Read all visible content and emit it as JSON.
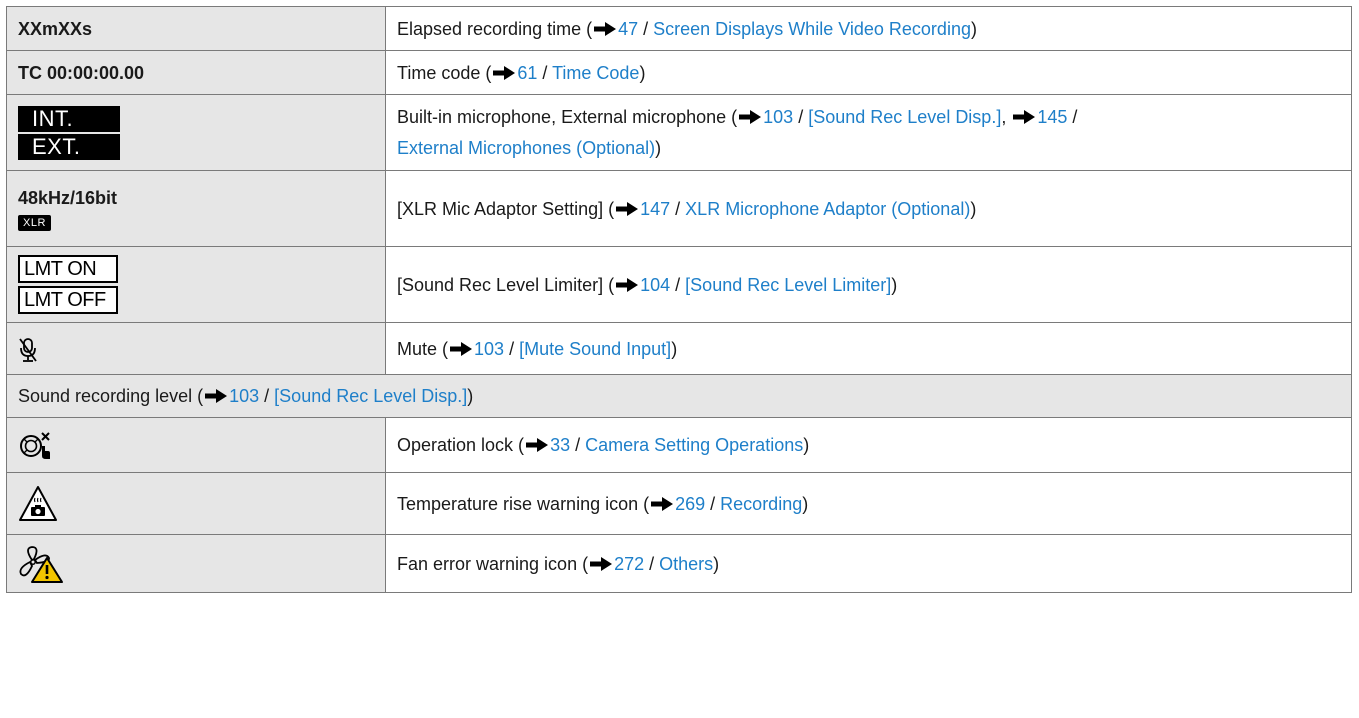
{
  "rows": [
    {
      "icon_text": "XXmXXs",
      "desc": "Elapsed recording time (",
      "page": "47",
      "sep": " / ",
      "link": "Screen Displays While Video Recording",
      "end": ")"
    },
    {
      "icon_text": "TC 00:00:00.00",
      "desc": "Time code (",
      "page": "61",
      "sep": " / ",
      "link": "Time Code",
      "end": ")"
    },
    {
      "icon_text_1": "INT.",
      "icon_text_2": "EXT.",
      "desc": "Built-in microphone, External microphone (",
      "page": "103",
      "sep": " / ",
      "link": "[Sound Rec Level Disp.]",
      "mid": ", ",
      "page2": "145",
      "sep2": " /",
      "link2": "External Microphones (Optional)",
      "end": ")"
    },
    {
      "icon_text": "48kHz/16bit",
      "badge": "XLR",
      "desc": "[XLR Mic Adaptor Setting] (",
      "page": "147",
      "sep": " / ",
      "link": "XLR Microphone Adaptor (Optional)",
      "end": ")"
    },
    {
      "icon_text_1": "LMT ON",
      "icon_text_2": "LMT OFF",
      "desc": "[Sound Rec Level Limiter] (",
      "page": "104",
      "sep": " / ",
      "link": "[Sound Rec Level Limiter]",
      "end": ")"
    },
    {
      "icon": "mic-mute-icon",
      "desc": "Mute (",
      "page": "103",
      "sep": " / ",
      "link": "[Mute Sound Input]",
      "end": ")"
    },
    {
      "desc": "Sound recording level (",
      "page": "103",
      "sep": " / ",
      "link": "[Sound Rec Level Disp.]",
      "end": ")"
    },
    {
      "icon": "operation-lock-icon",
      "desc": "Operation lock (",
      "page": "33",
      "sep": " / ",
      "link": "Camera Setting Operations",
      "end": ")"
    },
    {
      "icon": "temperature-warning-icon",
      "desc": "Temperature rise warning icon (",
      "page": "269",
      "sep": " / ",
      "link": "Recording",
      "end": ")"
    },
    {
      "icon": "fan-error-warning-icon",
      "desc": "Fan error warning icon (",
      "page": "272",
      "sep": " / ",
      "link": "Others",
      "end": ")"
    }
  ],
  "colors": {
    "link": "#1e7fc9",
    "shade": "#e6e6e6",
    "warning": "#f2c500"
  }
}
